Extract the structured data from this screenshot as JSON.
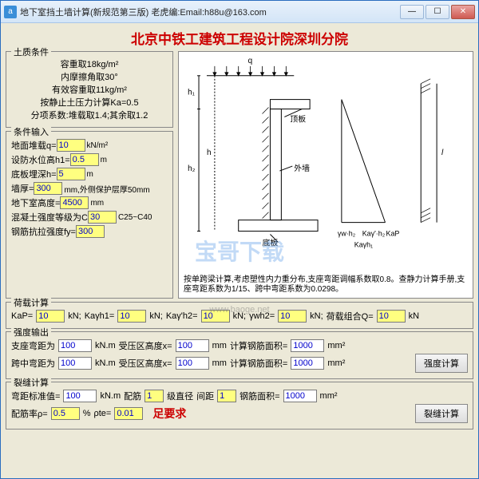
{
  "titlebar": {
    "icon": "a",
    "text": "地下室挡土墙计算(新规范第三版)  老虎编:Email:h88u@163.com",
    "min": "—",
    "max": "☐",
    "close": "✕"
  },
  "main_title": "北京中铁工建筑工程设计院深圳分院",
  "soil": {
    "group_title": "土质条件",
    "l1": "容重取18kg/m²",
    "l2": "内摩擦角取30°",
    "l3": "有效容重取11kg/m²",
    "l4": "按静止土压力计算Ka=0.5",
    "l5": "分项系数:堆载取1.4;其余取1.2"
  },
  "cond": {
    "group_title": "条件输入",
    "q_label": "地面堆载q=",
    "q_val": "10",
    "q_unit": "kN/m²",
    "h1_label": "设防水位高h1=",
    "h1_val": "0.5",
    "h1_unit": "m",
    "h_label": "底板埋深h=",
    "h_val": "5",
    "h_unit": "m",
    "wt_label": "墙厚=",
    "wt_val": "300",
    "wt_unit": "mm,外侧保护层厚50mm",
    "hr_label": "地下室高度=",
    "hr_val": "4500",
    "hr_unit": "mm",
    "conc_label": "混凝土强度等级为C",
    "conc_val": "30",
    "conc_unit": "C25~C40",
    "fy_label": "钢筋抗拉强度fy=",
    "fy_val": "300"
  },
  "diagram": {
    "q": "q",
    "h1": "h₁",
    "h2": "h₂",
    "h": "h",
    "roof": "顶板",
    "wall": "外墙",
    "floor": "底板",
    "d1": "γw·h₂",
    "d2": "Kaγ'·h₂",
    "d3": "KaP",
    "d4": "Kaγh₁",
    "l": "l",
    "note": "按单跨梁计算,考虑塑性内力重分布,支座弯距调幅系数取0.8。查静力计算手册,支座弯距系数为1/15、跨中弯距系数为0.0298。"
  },
  "load": {
    "group_title": "荷载计算",
    "kap_l": "KaP=",
    "kap_v": "10",
    "kap_u": "kN;",
    "kagh1_l": "Kaγh1=",
    "kagh1_v": "10",
    "kagh1_u": "kN;",
    "kagh2_l": "Kaγ'h2=",
    "kagh2_v": "10",
    "kagh2_u": "kN;",
    "gwh2_l": "γwh2=",
    "gwh2_v": "10",
    "gwh2_u": "kN;",
    "comb_l": "荷载组合Q=",
    "comb_v": "10",
    "comb_u": "kN"
  },
  "strength": {
    "group_title": "强度输出",
    "m1_l": "支座弯距为",
    "m1_v": "100",
    "m1_u": "kN.m",
    "x1_l": "受压区高度x=",
    "x1_v": "100",
    "x1_u": "mm",
    "a1_l": "计算钢筋面积=",
    "a1_v": "1000",
    "a1_u": "mm²",
    "m2_l": "跨中弯距为",
    "m2_v": "100",
    "m2_u": "kN.m",
    "x2_l": "受压区高度x=",
    "x2_v": "100",
    "x2_u": "mm",
    "a2_l": "计算钢筋面积=",
    "a2_v": "1000",
    "a2_u": "mm²",
    "btn": "强度计算"
  },
  "crack": {
    "group_title": "裂缝计算",
    "ms_l": "弯距标准值=",
    "ms_v": "100",
    "ms_u": "kN.m",
    "bar_l": "配筋",
    "bar_v": "1",
    "bar_u": "级直径",
    "sp_l": "间距",
    "sp_v": "1",
    "as_l": "钢筋面积=",
    "as_v": "1000",
    "as_u": "mm²",
    "rho_l": "配筋率ρ=",
    "rho_v": "0.5",
    "rho_u": "%",
    "pte_l": "ρte=",
    "pte_v": "0.01",
    "result": "足要求",
    "btn": "裂缝计算"
  },
  "watermark": {
    "main": "宝哥下载",
    "sub": "www.baoge.net"
  }
}
